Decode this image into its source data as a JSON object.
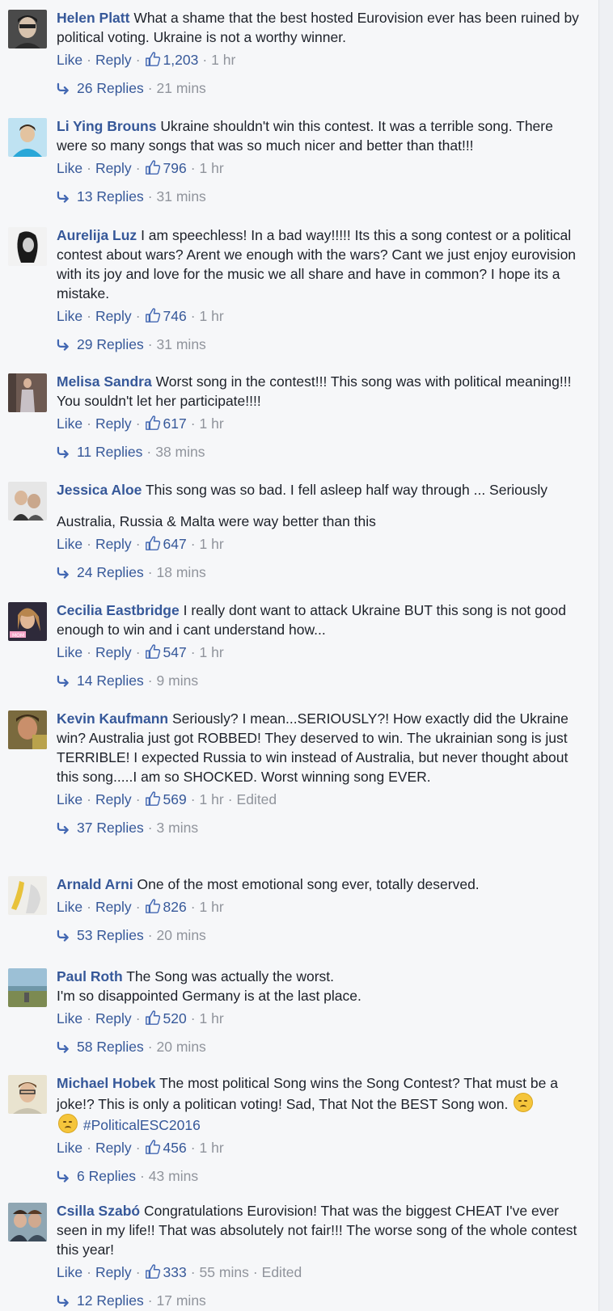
{
  "labels": {
    "like": "Like",
    "reply": "Reply",
    "dot": "·"
  },
  "colors": {
    "link": "#365899",
    "meta": "#90949c",
    "text": "#1d2129",
    "background": "#f6f7f9"
  },
  "icons": {
    "like": "thumbs-up-icon",
    "replies": "reply-arrow-icon",
    "emoji": "disappointed-face-emoji"
  },
  "comments": [
    {
      "author": "Helen Platt",
      "text": "What a shame that the best hosted Eurovision ever has been ruined by political voting. Ukraine is not a worthy winner.",
      "likes": "1,203",
      "time": "1 hr",
      "replies": "26 Replies",
      "replies_time": "21 mins"
    },
    {
      "author": "Li Ying Brouns",
      "text": "Ukraine shouldn't win this contest. It was a terrible song. There were so many songs that was so much nicer and better than that!!!",
      "likes": "796",
      "time": "1 hr",
      "replies": "13 Replies",
      "replies_time": "31 mins"
    },
    {
      "author": "Aurelija Luz",
      "text": "I am speechless! In a bad way!!!!! Its this a song contest or a political contest about wars? Arent we enough with the wars? Cant we just enjoy eurovision with its joy and love for the music we all share and have in common? I hope its a mistake.",
      "likes": "746",
      "time": "1 hr",
      "replies": "29 Replies",
      "replies_time": "31 mins"
    },
    {
      "author": "Melisa Sandra",
      "text": "Worst song in the contest!!! This song was with political meaning!!! You souldn't let her participate!!!!",
      "likes": "617",
      "time": "1 hr",
      "replies": "11 Replies",
      "replies_time": "38 mins"
    },
    {
      "author": "Jessica Aloe",
      "text": "This song was so bad. I fell asleep half way through ... Seriously",
      "text2": "Australia, Russia & Malta were way better than this",
      "likes": "647",
      "time": "1 hr",
      "replies": "24 Replies",
      "replies_time": "18 mins"
    },
    {
      "author": "Cecilia Eastbridge",
      "text": "I really dont want to attack Ukraine BUT this song is not good enough to win and i cant understand how...",
      "likes": "547",
      "time": "1 hr",
      "replies": "14 Replies",
      "replies_time": "9 mins"
    },
    {
      "author": "Kevin Kaufmann",
      "text": "Seriously? I mean...SERIOUSLY?! How exactly did the Ukraine win? Australia just got ROBBED! They deserved to win. The ukrainian song is just TERRIBLE! I expected Russia to win instead of Australia, but never thought about this song.....I am so SHOCKED. Worst winning song EVER.",
      "likes": "569",
      "time": "1 hr",
      "edited": "Edited",
      "replies": "37 Replies",
      "replies_time": "3 mins"
    },
    {
      "author": "Arnald Arni",
      "text": "One of the most emotional song ever, totally deserved.",
      "likes": "826",
      "time": "1 hr",
      "replies": "53 Replies",
      "replies_time": "20 mins"
    },
    {
      "author": "Paul Roth",
      "text": "The Song was actually the worst.",
      "text2": "I'm so disappointed Germany is at the last place.",
      "likes": "520",
      "time": "1 hr",
      "replies": "58 Replies",
      "replies_time": "20 mins"
    },
    {
      "author": "Michael Hobek",
      "text": "The most political Song wins the Song Contest? That must be a joke!? This is only a politican voting! Sad, That Not the BEST Song won.",
      "hashtag": "#PoliticalESC2016",
      "likes": "456",
      "time": "1 hr",
      "replies": "6 Replies",
      "replies_time": "43 mins"
    },
    {
      "author": "Csilla Szabó",
      "text": "Congratulations Eurovision! That was the biggest CHEAT I've ever seen in my life!! That was absolutely not fair!!! The worse song of the whole contest this year!",
      "likes": "333",
      "time": "55 mins",
      "edited": "Edited",
      "replies": "12 Replies",
      "replies_time": "17 mins"
    }
  ]
}
